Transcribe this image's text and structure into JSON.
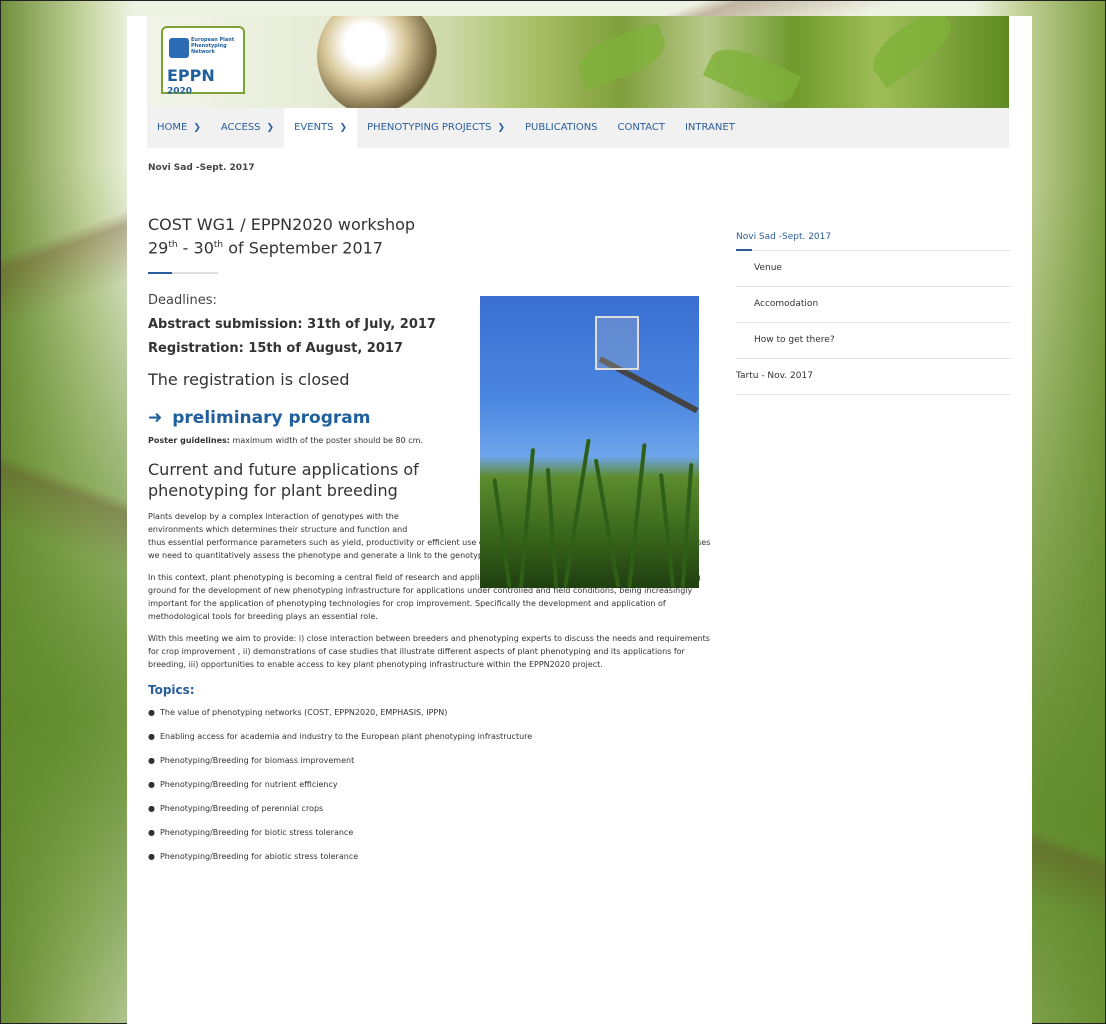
{
  "header": {
    "logo": {
      "small_text": "European Plant Phenotyping Network",
      "big_text": "EPPN",
      "big_suffix": "2020"
    }
  },
  "nav": {
    "items": [
      {
        "label": "HOME",
        "dropdown": true
      },
      {
        "label": "ACCESS",
        "dropdown": true
      },
      {
        "label": "EVENTS",
        "dropdown": true,
        "active": true
      },
      {
        "label": "PHENOTYPING PROJECTS",
        "dropdown": true
      },
      {
        "label": "PUBLICATIONS",
        "dropdown": false
      },
      {
        "label": "CONTACT",
        "dropdown": false
      },
      {
        "label": "INTRANET",
        "dropdown": false
      }
    ]
  },
  "breadcrumb": "Novi Sad -Sept. 2017",
  "main": {
    "title_line1": "COST WG1 / EPPN2020 workshop",
    "title_day1": "29",
    "title_sup1": "th",
    "title_mid": " - 30",
    "title_sup2": "th",
    "title_end": " of September 2017",
    "deadlines_label": "Deadlines:",
    "abstract_deadline": "Abstract submission: 31th of July, 2017",
    "registration_deadline": "Registration: 15th of August, 2017",
    "registration_status": "The registration is closed",
    "program_link": "preliminary program",
    "program_icon": "arrow-right-icon",
    "poster_label": "Poster guidelines:",
    "poster_text": " maximum width of the poster should be 80 cm.",
    "section_title": "Current and future applications of phenotyping for plant breeding",
    "para1a": "Plants develop by a complex interaction of genotypes with the environments which determines their structure and function and",
    "para1b": "thus essential performance parameters such as yield, productivity or efficient use of resources. To understand these fundamental processes we need to quantitatively assess the phenotype and generate a link to the genotype in order to understand the genetic basis.",
    "para2": "In this context, plant phenotyping is becoming a central field of research and application in academia and industry providing a nourishing ground for the development of new phenotyping infrastructure for applications under controlled and field conditions, being increasingly important for the application of phenotyping technologies for crop improvement. Specifically the development and application of methodological tools for breeding plays an essential role.",
    "para3": "With this meeting we aim to provide: i) close interaction between breeders and phenotyping experts to discuss the needs and requirements for crop improvement , ii) demonstrations of case studies that illustrate different aspects of plant phenotyping and its applications for breeding, iii) opportunities to enable access to key plant phenotyping infrastructure within the EPPN2020 project.",
    "topics_title": "Topics:",
    "topics": [
      "The value of phenotyping networks (COST, EPPN2020, EMPHASIS, IPPN)",
      "Enabling access for academia and industry to the European plant phenotyping infrastructure",
      "Phenotyping/Breeding for biomass improvement",
      "Phenotyping/Breeding for nutrient efficiency",
      "Phenotyping/Breeding of perennial crops",
      "Phenotyping/Breeding for biotic stress tolerance",
      "Phenotyping/Breeding for abiotic stress tolerance"
    ]
  },
  "sidebar": {
    "heading": "Novi Sad -Sept. 2017",
    "items": [
      {
        "label": "Venue",
        "sub": true
      },
      {
        "label": "Accomodation",
        "sub": true
      },
      {
        "label": "How to get there?",
        "sub": true
      },
      {
        "label": "Tartu - Nov. 2017",
        "sub": false
      }
    ]
  },
  "colors": {
    "accent": "#2a5d9c",
    "nav_bg": "#f1f1f1"
  }
}
